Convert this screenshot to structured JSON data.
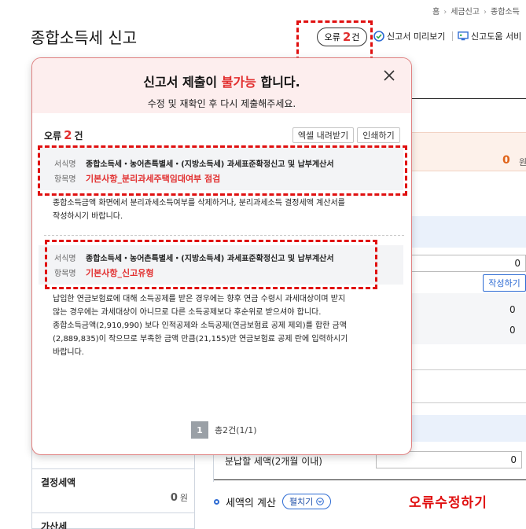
{
  "breadcrumb": {
    "home": "홈",
    "level1": "세금신고",
    "level2": "종합소득"
  },
  "page_title": "종합소득세 신고",
  "header": {
    "error_prefix": "오류",
    "error_count": "2",
    "error_suffix": "건",
    "preview_label": "신고서 미리보기",
    "help_label": "신고도움 서비"
  },
  "modal": {
    "title_prefix": "신고서 제출이 ",
    "title_highlight": "불가능",
    "title_suffix": " 합니다.",
    "subtitle": "수정 및 재확인 후 다시 제출해주세요.",
    "count_prefix": "오류",
    "count_value": "2",
    "count_suffix": "건",
    "excel_button": "엑셀 내려받기",
    "print_button": "인쇄하기",
    "errors": [
      {
        "form_key": "서식명",
        "form_value": "종합소득세・농어촌특별세・(지방소득세) 과세표준확정신고 및 납부계산서",
        "item_key": "항목명",
        "item_value": "기본사항_분리과세주택임대여부 점검",
        "description_lines": [
          "종합소득금액 화면에서 분리과세소득여부를 삭제하거나, 분리과세소득 결정세액 계산서를",
          "작성하시기 바랍니다."
        ]
      },
      {
        "form_key": "서식명",
        "form_value": "종합소득세・농어촌특별세・(지방소득세) 과세표준확정신고 및 납부계산서",
        "item_key": "항목명",
        "item_value": "기본사항_신고유형",
        "description_lines": [
          "납입한 연금보험료에 대해 소득공제를 받은 경우에는 향후 연금 수령시 과세대상이며 받지",
          "않는 경우에는 과세대상이 아니므로 다른 소득공제보다 후순위로 받으셔야 합니다.",
          "종합소득금액(2,910,990) 보다 인적공제와 소득공제(연금보험료 공제 제외)를 합한 금액",
          "(2,889,835)이 작으므로 부족한 금액 만큼(21,155)만 연금보험료 공제 란에 입력하시기",
          "바랍니다."
        ]
      }
    ],
    "pager": {
      "current": "1",
      "total_text": "총2건(1/1)"
    }
  },
  "background": {
    "pink_value": "0",
    "won": "원",
    "input_value_1": "0",
    "write_button": "작성하기",
    "row_value_1": "0",
    "row_value_2": "0",
    "installment_label": "분납할 세액(2개월 이내)",
    "installment_value": "0",
    "left_items": [
      {
        "label": "결정세액",
        "value": "0",
        "unit": "원"
      },
      {
        "label": "가산세"
      }
    ],
    "calc_title": "세액의 계산",
    "expand_button": "펼치기"
  },
  "annotation": "오류수정하기",
  "colors": {
    "error_red": "#e23030",
    "annotation_red": "#e01010",
    "accent_blue": "#2d6bd3",
    "modal_header_bg": "#fdeeee"
  }
}
